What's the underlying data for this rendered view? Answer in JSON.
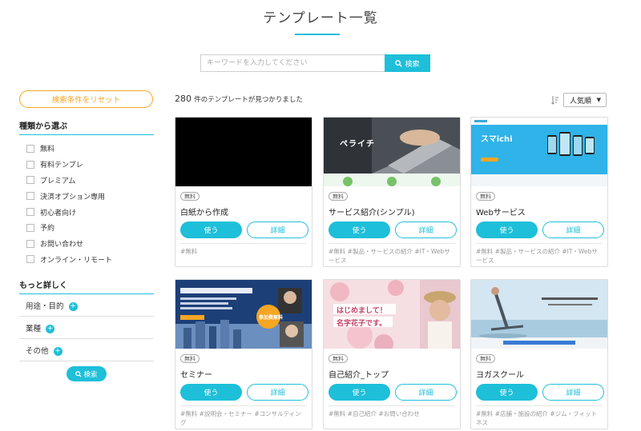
{
  "header": {
    "title": "テンプレート一覧"
  },
  "search": {
    "placeholder": "キーワードを入力してください",
    "button_label": "検索"
  },
  "sidebar": {
    "reset_label": "検索条件をリセット",
    "types_heading": "種類から選ぶ",
    "types": [
      "無料",
      "有料テンプレ",
      "プレミアム",
      "決済オプション専用",
      "初心者向け",
      "予約",
      "お問い合わせ",
      "オンライン・リモート"
    ],
    "details_heading": "もっと詳しく",
    "details": [
      "用途・目的",
      "業種",
      "その他"
    ],
    "search_label": "検索"
  },
  "results": {
    "count": "280",
    "count_suffix": "件のテンプレートが見つかりました",
    "sort_label": "人気順"
  },
  "cards": [
    {
      "badge": "無料",
      "title": "白紙から作成",
      "use_label": "使う",
      "detail_label": "詳細",
      "tags": "#無料"
    },
    {
      "badge": "無料",
      "title": "サービス紹介(シンプル)",
      "use_label": "使う",
      "detail_label": "詳細",
      "tags": "#無料 #製品・サービスの紹介 #IT・Webサービス",
      "thumb_text": "ペライチ"
    },
    {
      "badge": "無料",
      "title": "Webサービス",
      "use_label": "使う",
      "detail_label": "詳細",
      "tags": "#無料 #製品・サービスの紹介 #IT・Webサービス",
      "thumb_text": "スマichi"
    },
    {
      "badge": "無料",
      "title": "セミナー",
      "use_label": "使う",
      "detail_label": "詳細",
      "tags": "#無料 #説明会・セミナー #コンサルティング",
      "thumb_text": "参加費無料"
    },
    {
      "badge": "無料",
      "title": "自己紹介_トップ",
      "use_label": "使う",
      "detail_label": "詳細",
      "tags": "#無料 #自己紹介 #お問い合わせ",
      "thumb_text_1": "はじめまして！",
      "thumb_text_2": "名字花子です。"
    },
    {
      "badge": "無料",
      "title": "ヨガスクール",
      "use_label": "使う",
      "detail_label": "詳細",
      "tags": "#無料 #店舗・施設の紹介 #ジム・フィットネス"
    }
  ],
  "colors": {
    "accent": "#1ebfd9",
    "reset": "#f5a623"
  }
}
